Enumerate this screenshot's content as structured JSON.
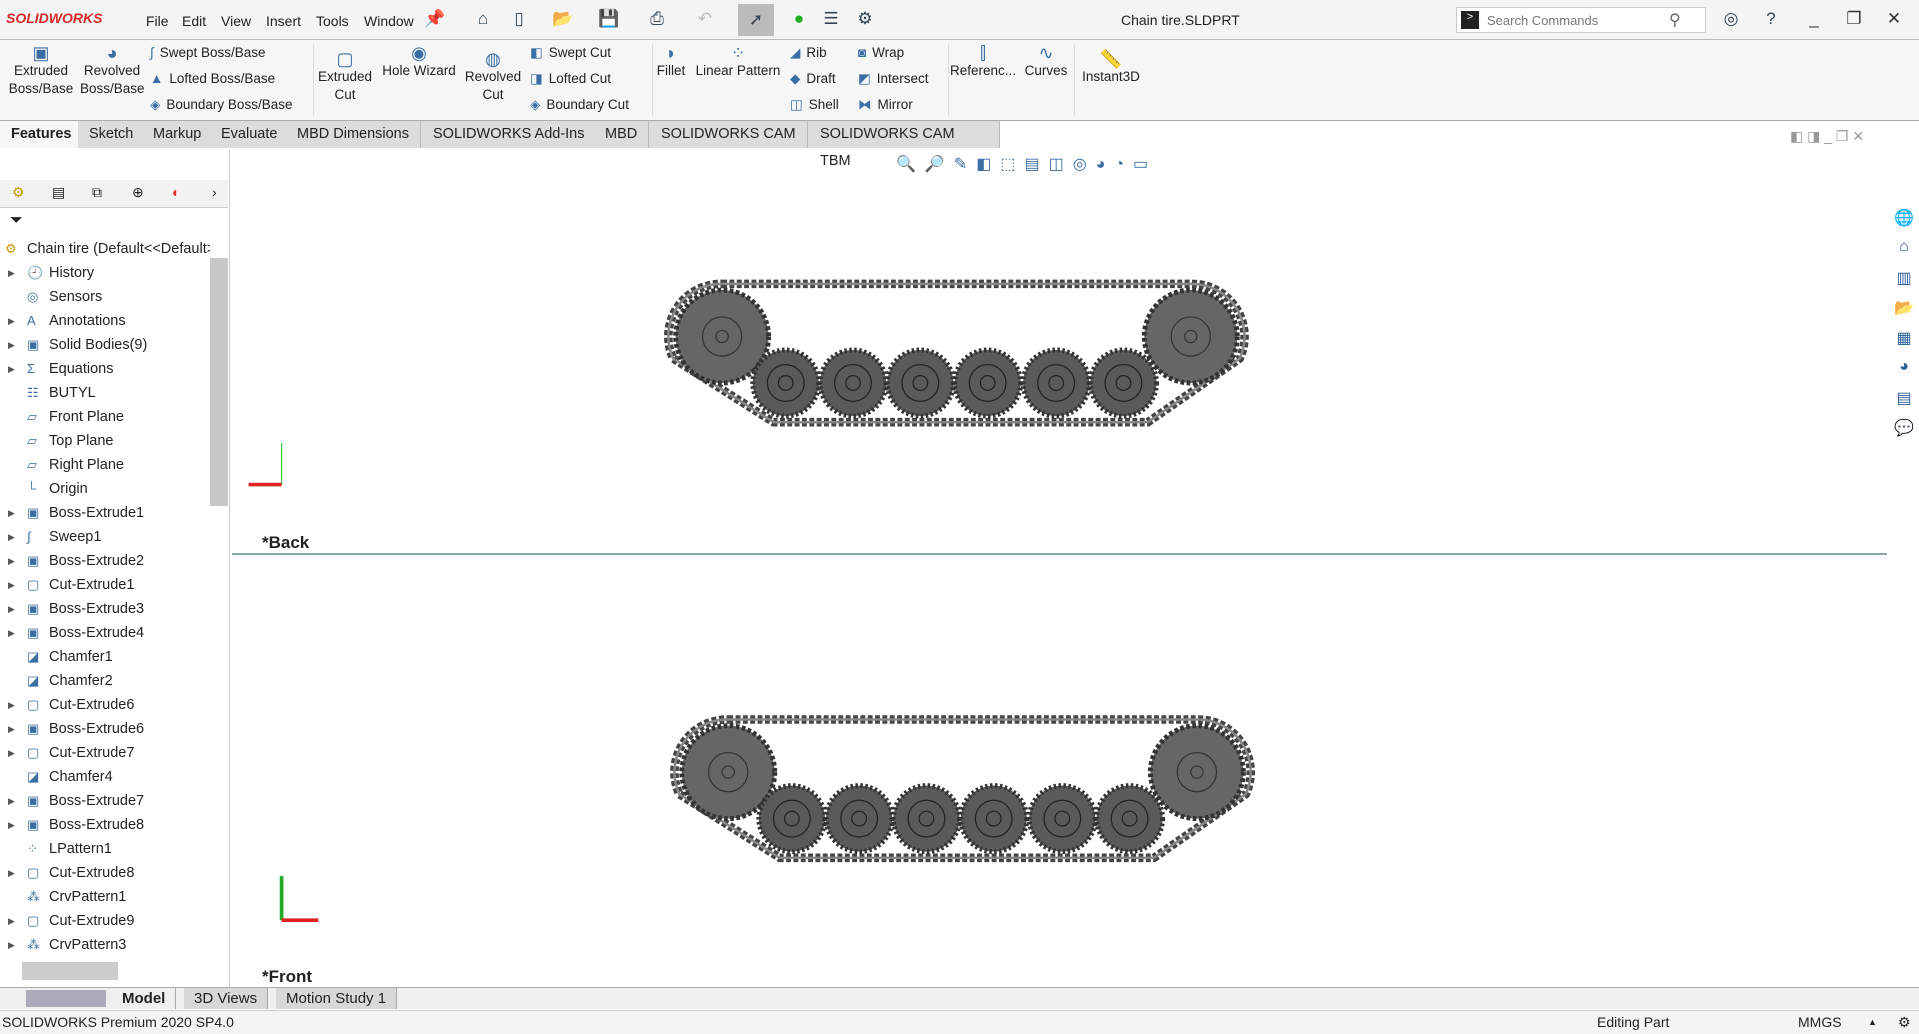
{
  "app": {
    "logo": "SOLIDWORKS",
    "title": "Chain tire.SLDPRT"
  },
  "menu": [
    "File",
    "Edit",
    "View",
    "Insert",
    "Tools",
    "Window"
  ],
  "search": {
    "placeholder": "Search Commands"
  },
  "ribbon": {
    "extruded_boss": "Extruded Boss/Base",
    "revolved_boss": "Revolved Boss/Base",
    "swept_boss": "Swept Boss/Base",
    "lofted_boss": "Lofted Boss/Base",
    "boundary_boss": "Boundary Boss/Base",
    "extruded_cut": "Extruded Cut",
    "hole_wizard": "Hole Wizard",
    "revolved_cut": "Revolved Cut",
    "swept_cut": "Swept Cut",
    "lofted_cut": "Lofted Cut",
    "boundary_cut": "Boundary Cut",
    "fillet": "Fillet",
    "linear_pattern": "Linear Pattern",
    "rib": "Rib",
    "draft": "Draft",
    "shell": "Shell",
    "wrap": "Wrap",
    "intersect": "Intersect",
    "mirror": "Mirror",
    "reference": "Referenc...",
    "curves": "Curves",
    "instant3d": "Instant3D"
  },
  "tabs": [
    "Features",
    "Sketch",
    "Markup",
    "Evaluate",
    "MBD Dimensions",
    "SOLIDWORKS Add-Ins",
    "MBD",
    "SOLIDWORKS CAM",
    "SOLIDWORKS CAM TBM"
  ],
  "tree": {
    "root": "Chain tire  (Default<<Default>",
    "items": [
      {
        "label": "History",
        "icon": "history-icon",
        "exp": true
      },
      {
        "label": "Sensors",
        "icon": "sensor-icon",
        "exp": false
      },
      {
        "label": "Annotations",
        "icon": "annotation-icon",
        "exp": true
      },
      {
        "label": "Solid Bodies(9)",
        "icon": "solid-bodies-icon",
        "exp": true
      },
      {
        "label": "Equations",
        "icon": "equations-icon",
        "exp": true
      },
      {
        "label": "BUTYL",
        "icon": "material-icon",
        "exp": false
      },
      {
        "label": "Front Plane",
        "icon": "plane-icon",
        "exp": false
      },
      {
        "label": "Top Plane",
        "icon": "plane-icon",
        "exp": false
      },
      {
        "label": "Right Plane",
        "icon": "plane-icon",
        "exp": false
      },
      {
        "label": "Origin",
        "icon": "origin-icon",
        "exp": false
      },
      {
        "label": "Boss-Extrude1",
        "icon": "extrude-icon",
        "exp": true
      },
      {
        "label": "Sweep1",
        "icon": "sweep-icon",
        "exp": true
      },
      {
        "label": "Boss-Extrude2",
        "icon": "extrude-icon",
        "exp": true
      },
      {
        "label": "Cut-Extrude1",
        "icon": "cut-icon",
        "exp": true
      },
      {
        "label": "Boss-Extrude3",
        "icon": "extrude-icon",
        "exp": true
      },
      {
        "label": "Boss-Extrude4",
        "icon": "extrude-icon",
        "exp": true
      },
      {
        "label": "Chamfer1",
        "icon": "chamfer-icon",
        "exp": false
      },
      {
        "label": "Chamfer2",
        "icon": "chamfer-icon",
        "exp": false
      },
      {
        "label": "Cut-Extrude6",
        "icon": "cut-icon",
        "exp": true
      },
      {
        "label": "Boss-Extrude6",
        "icon": "extrude-icon",
        "exp": true
      },
      {
        "label": "Cut-Extrude7",
        "icon": "cut-icon",
        "exp": true
      },
      {
        "label": "Chamfer4",
        "icon": "chamfer-icon",
        "exp": false
      },
      {
        "label": "Boss-Extrude7",
        "icon": "extrude-icon",
        "exp": true
      },
      {
        "label": "Boss-Extrude8",
        "icon": "extrude-icon",
        "exp": true
      },
      {
        "label": "LPattern1",
        "icon": "pattern-icon",
        "exp": false
      },
      {
        "label": "Cut-Extrude8",
        "icon": "cut-icon",
        "exp": true
      },
      {
        "label": "CrvPattern1",
        "icon": "curve-pattern-icon",
        "exp": false
      },
      {
        "label": "Cut-Extrude9",
        "icon": "cut-icon",
        "exp": true
      },
      {
        "label": "CrvPattern3",
        "icon": "curve-pattern-icon",
        "exp": true
      }
    ]
  },
  "viewports": {
    "top": "*Back",
    "bottom": "*Front"
  },
  "bottom_tabs": [
    "Model",
    "3D Views",
    "Motion Study 1"
  ],
  "status": {
    "product": "SOLIDWORKS Premium 2020 SP4.0",
    "mode": "Editing Part",
    "units": "MMGS"
  },
  "colors": {
    "brand": "#d62a2a",
    "track": "#555555"
  }
}
